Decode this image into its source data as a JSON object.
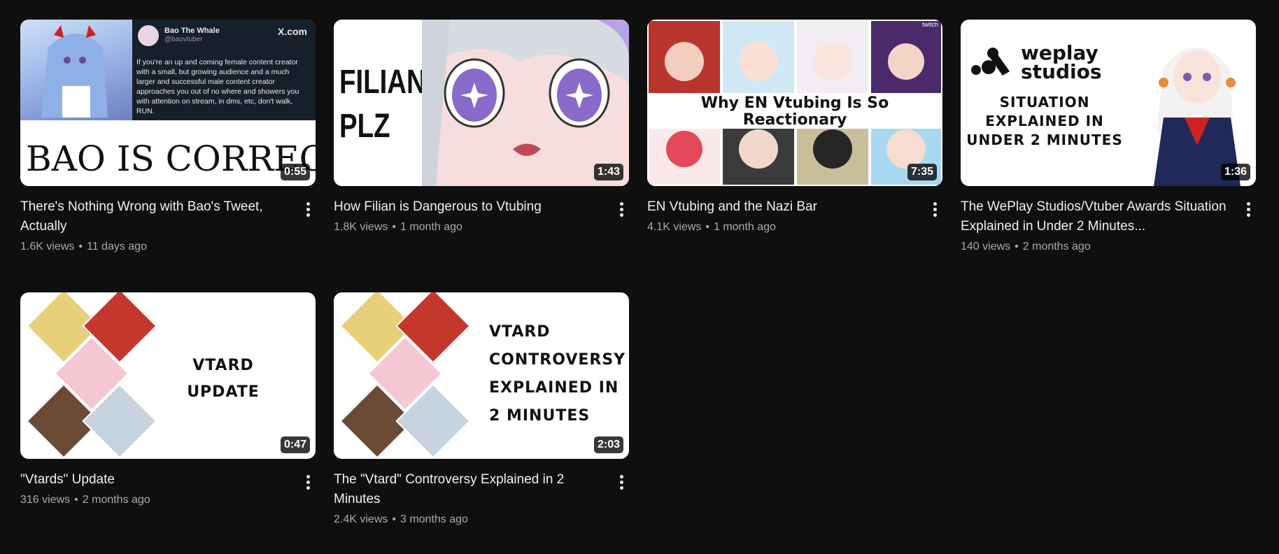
{
  "videos": [
    {
      "title": "There's Nothing Wrong with Bao's Tweet, Actually",
      "views": "1.6K views",
      "age": "11 days ago",
      "duration": "0:55",
      "thumb": {
        "headline": "BAO IS CORRECT",
        "tweet_name": "Bao The Whale",
        "tweet_handle": "@baovtuber",
        "tweet_site": "X.com",
        "tweet_body": "If you're an up and coming female content creator with a small, but growing audience and a much larger and successful male content creator approaches you out of no where and showers you with attention on stream, in dms, etc, don't walk, RUN."
      }
    },
    {
      "title": "How Filian is Dangerous to Vtubing",
      "views": "1.8K views",
      "age": "1 month ago",
      "duration": "1:43",
      "thumb": {
        "line1": "FILIAN",
        "line2": "PLZ"
      }
    },
    {
      "title": "EN Vtubing and the Nazi Bar",
      "views": "4.1K views",
      "age": "1 month ago",
      "duration": "7:35",
      "thumb": {
        "banner": "Why EN Vtubing Is So Reactionary",
        "corner": "twitch"
      }
    },
    {
      "title": "The WePlay Studios/Vtuber Awards Situation Explained in Under 2 Minutes...",
      "views": "140 views",
      "age": "2 months ago",
      "duration": "1:36",
      "thumb": {
        "logo_line1": "weplay",
        "logo_line2": "studios",
        "caption1": "SITUATION",
        "caption2": "EXPLAINED IN",
        "caption3": "UNDER 2 MINUTES"
      }
    },
    {
      "title": "\"Vtards\" Update",
      "views": "316 views",
      "age": "2 months ago",
      "duration": "0:47",
      "thumb": {
        "line1": "VTARD",
        "line2": "UPDATE"
      }
    },
    {
      "title": "The \"Vtard\" Controversy Explained in 2 Minutes",
      "views": "2.4K views",
      "age": "3 months ago",
      "duration": "2:03",
      "thumb": {
        "line1": "VTARD",
        "line2": "CONTROVERSY",
        "line3": "EXPLAINED IN",
        "line4": "2 MINUTES"
      }
    }
  ],
  "colors": {
    "background": "#0f0f0f",
    "title": "#f1f1f1",
    "meta": "#aaaaaa"
  },
  "icons": {
    "more": "more-vert-icon"
  }
}
